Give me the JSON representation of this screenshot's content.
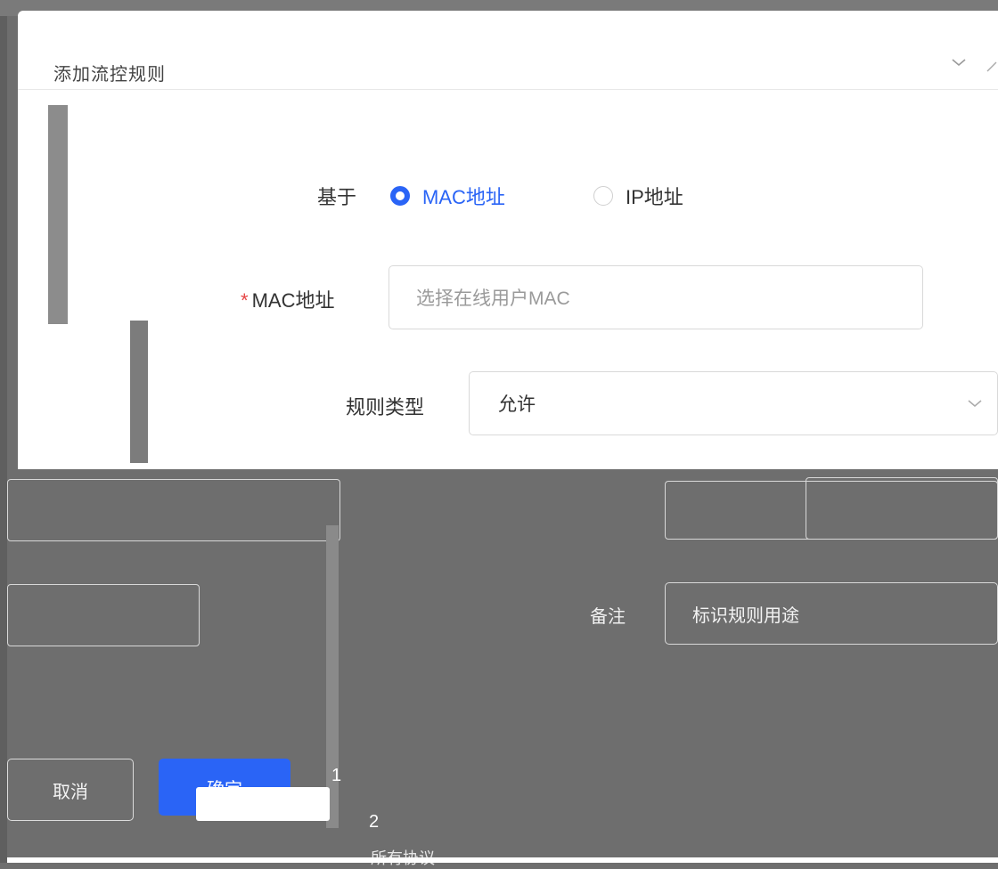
{
  "dialog": {
    "title": "添加流控规则"
  },
  "form": {
    "based_on_label": "基于",
    "options": [
      {
        "label": "MAC地址",
        "selected": true
      },
      {
        "label": "IP地址",
        "selected": false
      }
    ],
    "mac_label": "MAC地址",
    "mac_required": "*",
    "mac_placeholder": "选择在线用户MAC",
    "rule_type_label": "规则类型",
    "rule_type_value": "允许",
    "note_label": "备注",
    "note_placeholder": "标识规则用途"
  },
  "footer": {
    "cancel_label": "取消",
    "ok_label": "确定"
  },
  "pagination": {
    "page1": "1",
    "page2": "2"
  },
  "bottom": {
    "protocol_text": "所有协议"
  },
  "colors": {
    "accent": "#2a64f6",
    "required": "#e64545"
  }
}
